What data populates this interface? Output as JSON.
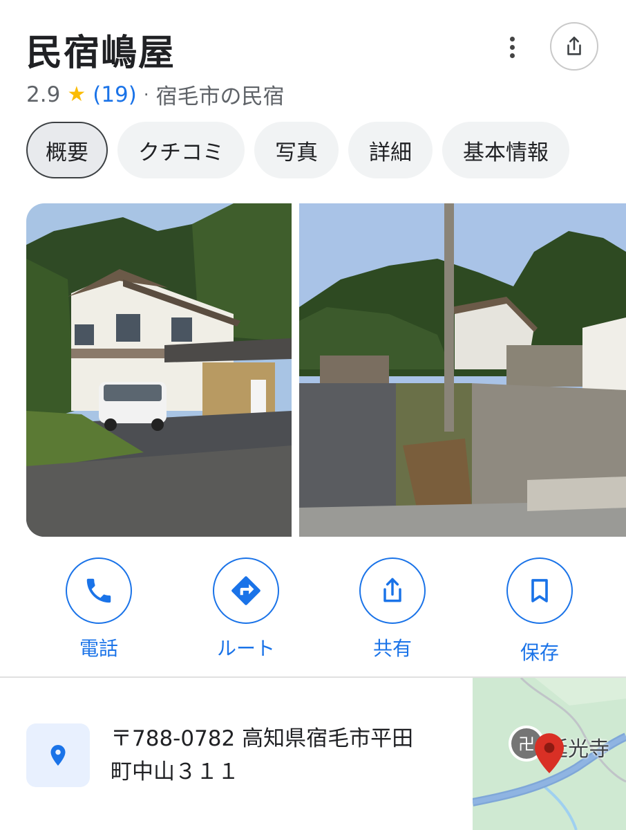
{
  "place": {
    "name": "民宿嶋屋",
    "rating": "2.9",
    "star_icon": "star-icon",
    "review_count": "(19)",
    "separator": "·",
    "category": "宿毛市の民宿"
  },
  "tabs": [
    {
      "label": "概要",
      "active": true
    },
    {
      "label": "クチコミ"
    },
    {
      "label": "写真"
    },
    {
      "label": "詳細"
    },
    {
      "label": "基本情報"
    }
  ],
  "actions": {
    "call": "電話",
    "route": "ルート",
    "share": "共有",
    "save": "保存"
  },
  "address": {
    "line1": "〒788-0782 高知県宿毛市平田",
    "line2": "町中山３１１"
  },
  "map": {
    "poi_label": "延光寺"
  },
  "colors": {
    "accent": "#1a73e8",
    "star": "#fbbc04",
    "pin": "#d93025"
  }
}
